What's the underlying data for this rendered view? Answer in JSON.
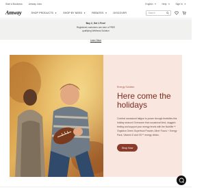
{
  "topbar": {
    "links": [
      "Start a Business",
      "Amway Jobs"
    ],
    "language": "English",
    "help": "Help",
    "sign_in": "Sign In"
  },
  "header": {
    "logo": "Amway",
    "nav": [
      "SHOP PRODUCTS",
      "SHOP BY NEED",
      "REBATES",
      "DISCOVER"
    ],
    "search_placeholder": "Search"
  },
  "promo": {
    "line1": "Buy 2, Get 1 Free!",
    "line2": "Registered customers can earn a FREE",
    "line3": "qualifying Wellness Solution",
    "link": "Learn More"
  },
  "hero": {
    "eyebrow": "Energy Solution",
    "headline": "Here come the holidays",
    "body": "Combat occasional fatigue to power through festivities this holiday season! Overcome that occasional tired, sluggish feeling and support your energy levels with the Nutrilite™ Organics Green Superfood Powder, Alive! Focus + Energy Pack, Vitamin D and XS™ energy drinks.",
    "cta": "Shop Now"
  },
  "colors": {
    "panel_bg": "#f8e6df",
    "headline": "#7a2c1f",
    "button": "#8a3b2b",
    "promo_bg": "#f1f1ef"
  },
  "icons": [
    "search-icon",
    "heart-icon",
    "cart-icon",
    "chat-icon"
  ]
}
